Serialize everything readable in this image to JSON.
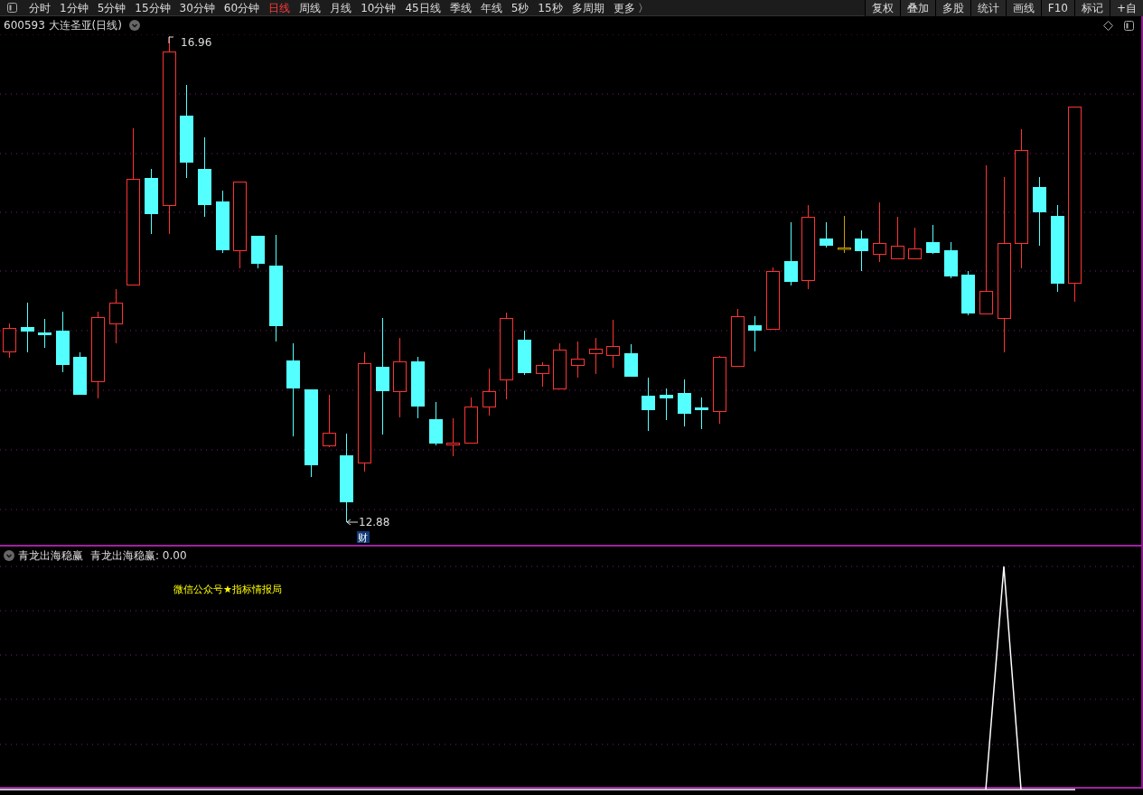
{
  "toolbar": {
    "periods": [
      {
        "label": "分时",
        "selected": false
      },
      {
        "label": "1分钟",
        "selected": false
      },
      {
        "label": "5分钟",
        "selected": false
      },
      {
        "label": "15分钟",
        "selected": false
      },
      {
        "label": "30分钟",
        "selected": false
      },
      {
        "label": "60分钟",
        "selected": false
      },
      {
        "label": "日线",
        "selected": true
      },
      {
        "label": "周线",
        "selected": false
      },
      {
        "label": "月线",
        "selected": false
      },
      {
        "label": "10分钟",
        "selected": false
      },
      {
        "label": "45日线",
        "selected": false
      },
      {
        "label": "季线",
        "selected": false
      },
      {
        "label": "年线",
        "selected": false
      },
      {
        "label": "5秒",
        "selected": false
      },
      {
        "label": "15秒",
        "selected": false
      },
      {
        "label": "多周期",
        "selected": false
      },
      {
        "label": "更多 〉",
        "selected": false
      }
    ],
    "tools": [
      "复权",
      "叠加",
      "多股",
      "统计",
      "画线",
      "F10",
      "标记",
      "+自"
    ]
  },
  "main_chart": {
    "title": "600593 大连圣亚(日线)",
    "high_label": "16.96",
    "low_label": "12.88",
    "event_badge": "财"
  },
  "indicator": {
    "title": "青龙出海稳赢",
    "value_text": "青龙出海稳赢: 0.00",
    "caption": "微信公众号★指标情报局"
  }
}
